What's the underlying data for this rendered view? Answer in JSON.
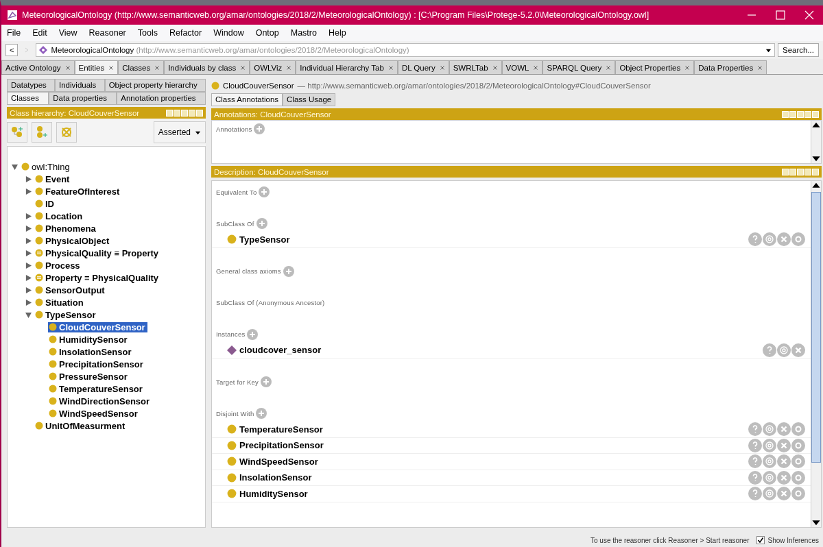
{
  "window": {
    "title": "MeteorologicalOntology (http://www.semanticweb.org/amar/ontologies/2018/2/MeteorologicalOntology) : [C:\\Program Files\\Protege-5.2.0\\MeteorologicalOntology.owl]"
  },
  "menu": [
    "File",
    "Edit",
    "View",
    "Reasoner",
    "Tools",
    "Refactor",
    "Window",
    "Ontop",
    "Mastro",
    "Help"
  ],
  "address": {
    "back": "<",
    "ontology": "MeteorologicalOntology",
    "iri": "(http://www.semanticweb.org/amar/ontologies/2018/2/MeteorologicalOntology)",
    "search": "Search..."
  },
  "tabs": [
    {
      "label": "Active Ontology",
      "selected": false
    },
    {
      "label": "Entities",
      "selected": true
    },
    {
      "label": "Classes",
      "selected": false
    },
    {
      "label": "Individuals by class",
      "selected": false
    },
    {
      "label": "OWLViz",
      "selected": false
    },
    {
      "label": "Individual Hierarchy Tab",
      "selected": false
    },
    {
      "label": "DL Query",
      "selected": false
    },
    {
      "label": "SWRLTab",
      "selected": false
    },
    {
      "label": "VOWL",
      "selected": false
    },
    {
      "label": "SPARQL Query",
      "selected": false
    },
    {
      "label": "Object Properties",
      "selected": false
    },
    {
      "label": "Data Properties",
      "selected": false
    }
  ],
  "left": {
    "tab_rows": [
      [
        {
          "label": "Datatypes",
          "selected": false
        },
        {
          "label": "Individuals",
          "selected": false
        },
        {
          "label": "Object property hierarchy",
          "selected": false
        }
      ],
      [
        {
          "label": "Classes",
          "selected": true
        },
        {
          "label": "Data properties",
          "selected": false
        },
        {
          "label": "Annotation properties",
          "selected": false
        }
      ]
    ],
    "panel_title": "Class hierarchy: CloudCouverSensor",
    "mode": "Asserted",
    "tree": [
      {
        "label": "owl:Thing",
        "bold": false,
        "expanded": true,
        "selected": false,
        "defined": false,
        "children": [
          {
            "label": "Event",
            "bold": true,
            "expanded": false,
            "selected": false,
            "defined": false
          },
          {
            "label": "FeatureOfInterest",
            "bold": true,
            "expanded": false,
            "selected": false,
            "defined": false
          },
          {
            "label": "ID",
            "bold": true,
            "selected": false,
            "defined": false
          },
          {
            "label": "Location",
            "bold": true,
            "expanded": false,
            "selected": false,
            "defined": false
          },
          {
            "label": "Phenomena",
            "bold": true,
            "expanded": false,
            "selected": false,
            "defined": false
          },
          {
            "label": "PhysicalObject",
            "bold": true,
            "expanded": false,
            "selected": false,
            "defined": false
          },
          {
            "label": "PhysicalQuality ≡ Property",
            "bold": true,
            "expanded": false,
            "selected": false,
            "defined": true
          },
          {
            "label": "Process",
            "bold": true,
            "expanded": false,
            "selected": false,
            "defined": false
          },
          {
            "label": "Property ≡ PhysicalQuality",
            "bold": true,
            "expanded": false,
            "selected": false,
            "defined": true
          },
          {
            "label": "SensorOutput",
            "bold": true,
            "expanded": false,
            "selected": false,
            "defined": false
          },
          {
            "label": "Situation",
            "bold": true,
            "expanded": false,
            "selected": false,
            "defined": false
          },
          {
            "label": "TypeSensor",
            "bold": true,
            "expanded": true,
            "selected": false,
            "defined": false,
            "children": [
              {
                "label": "CloudCouverSensor",
                "bold": true,
                "selected": true,
                "defined": false
              },
              {
                "label": "HumiditySensor",
                "bold": true,
                "selected": false,
                "defined": false
              },
              {
                "label": "InsolationSensor",
                "bold": true,
                "selected": false,
                "defined": false
              },
              {
                "label": "PrecipitationSensor",
                "bold": true,
                "selected": false,
                "defined": false
              },
              {
                "label": "PressureSensor",
                "bold": true,
                "selected": false,
                "defined": false
              },
              {
                "label": "TemperatureSensor",
                "bold": true,
                "selected": false,
                "defined": false
              },
              {
                "label": "WindDirectionSensor",
                "bold": true,
                "selected": false,
                "defined": false
              },
              {
                "label": "WindSpeedSensor",
                "bold": true,
                "selected": false,
                "defined": false
              }
            ]
          },
          {
            "label": "UnitOfMeasurment",
            "bold": true,
            "selected": false,
            "defined": false
          }
        ]
      }
    ]
  },
  "right": {
    "entity": "CloudCouverSensor",
    "iri": "— http://www.semanticweb.org/amar/ontologies/2018/2/MeteorologicalOntology#CloudCouverSensor",
    "tabs": [
      {
        "label": "Class Annotations",
        "selected": true
      },
      {
        "label": "Class Usage",
        "selected": false
      }
    ],
    "annotations": {
      "title": "Annotations: CloudCouverSensor",
      "label": "Annotations"
    },
    "description": {
      "title": "Description: CloudCouverSensor",
      "sections": [
        {
          "label": "Equivalent To",
          "addable": true
        },
        {
          "label": "SubClass Of",
          "addable": true,
          "items": [
            {
              "label": "TypeSensor",
              "kind": "class",
              "editable": true
            }
          ]
        },
        {
          "label": "General class axioms",
          "addable": true
        },
        {
          "label": "SubClass Of (Anonymous Ancestor)",
          "addable": false
        },
        {
          "label": "Instances",
          "addable": true,
          "items": [
            {
              "label": "cloudcover_sensor",
              "kind": "individual",
              "editable": false
            }
          ]
        },
        {
          "label": "Target for Key",
          "addable": true
        },
        {
          "label": "Disjoint With",
          "addable": true,
          "items": [
            {
              "label": "TemperatureSensor",
              "kind": "class",
              "editable": true
            },
            {
              "label": "PrecipitationSensor",
              "kind": "class",
              "editable": true
            },
            {
              "label": "WindSpeedSensor",
              "kind": "class",
              "editable": true
            },
            {
              "label": "InsolationSensor",
              "kind": "class",
              "editable": true
            },
            {
              "label": "HumiditySensor",
              "kind": "class",
              "editable": true
            }
          ]
        }
      ]
    }
  },
  "status_bar": {
    "message": "To use the reasoner click Reasoner > Start reasoner",
    "show_inferences": {
      "label": "Show Inferences",
      "checked": true
    }
  }
}
